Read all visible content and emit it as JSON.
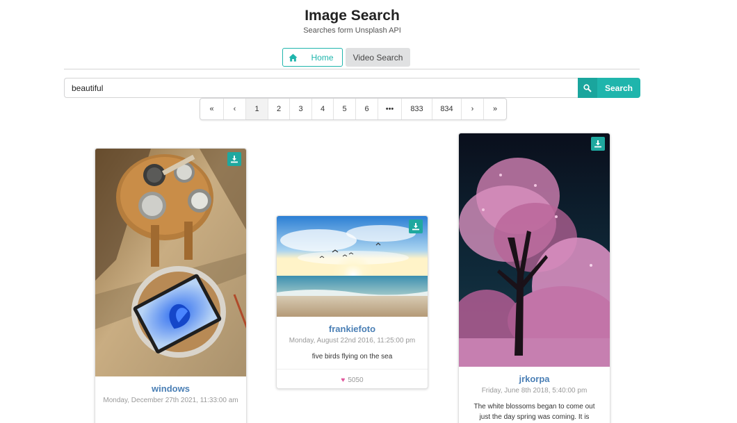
{
  "header": {
    "title": "Image Search",
    "subtitle": "Searches form Unsplash API"
  },
  "nav": {
    "home_label": "Home",
    "video_label": "Video Search"
  },
  "search": {
    "value": "beautiful",
    "button_label": "Search"
  },
  "pagination": {
    "first": "«",
    "prev": "‹",
    "pages": [
      "1",
      "2",
      "3",
      "4",
      "5",
      "6"
    ],
    "ellipsis": "•••",
    "last_pages": [
      "833",
      "834"
    ],
    "next": "›",
    "last": "»",
    "active": "1"
  },
  "cards": [
    {
      "name": "windows",
      "date": "Monday, December 27th 2021, 11:33:00 am",
      "icon": "download-icon"
    },
    {
      "name": "frankiefoto",
      "date": "Monday, August 22nd 2016, 11:25:00 pm",
      "description": "five birds flying on the sea",
      "likes": "5050",
      "icon": "download-icon"
    },
    {
      "name": "jrkorpa",
      "date": "Friday, June 8th 2018, 5:40:00 pm",
      "description": "The white blossoms began to come out just the day spring was coming. It is",
      "icon": "download-icon"
    }
  ],
  "colors": {
    "accent": "#1fb5ac",
    "name_link": "#4a7fb5",
    "heart": "#e0559b"
  }
}
